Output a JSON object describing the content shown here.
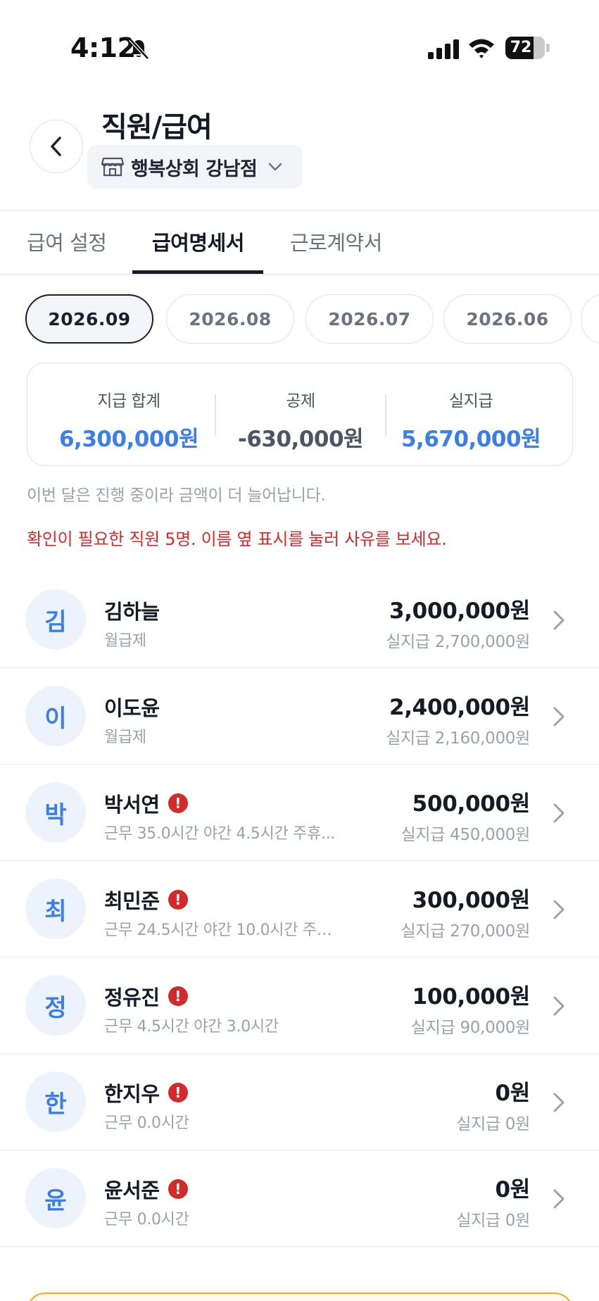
{
  "status_bar": {
    "time": "4:12",
    "battery": "72",
    "battery_level": 0.72
  },
  "header": {
    "title": "직원/급여",
    "store_name": "행복상회 강남점"
  },
  "tabs": [
    {
      "label": "급여 설정",
      "active": false
    },
    {
      "label": "급여명세서",
      "active": true
    },
    {
      "label": "근로계약서",
      "active": false
    }
  ],
  "months": [
    {
      "label": "2026.09",
      "active": true
    },
    {
      "label": "2026.08",
      "active": false
    },
    {
      "label": "2026.07",
      "active": false
    },
    {
      "label": "2026.06",
      "active": false
    }
  ],
  "summary": {
    "total_label": "지급 합계",
    "total_value": "6,300,000원",
    "deduction_label": "공제",
    "deduction_value": "-630,000원",
    "net_label": "실지급",
    "net_value": "5,670,000원"
  },
  "info_note": "이번 달은 진행 중이라 금액이 더 늘어납니다.",
  "warning": "확인이 필요한 직원 5명. 이름 옆 표시를 눌러 사유를 보세요.",
  "employees": [
    {
      "initial": "김",
      "name": "김하늘",
      "sub": "월급제",
      "amount": "3,000,000원",
      "net": "실지급 2,700,000원",
      "alert": false
    },
    {
      "initial": "이",
      "name": "이도윤",
      "sub": "월급제",
      "amount": "2,400,000원",
      "net": "실지급 2,160,000원",
      "alert": false
    },
    {
      "initial": "박",
      "name": "박서연",
      "sub": "근무 35.0시간  야간 4.5시간  주휴...",
      "amount": "500,000원",
      "net": "실지급 450,000원",
      "alert": true
    },
    {
      "initial": "최",
      "name": "최민준",
      "sub": "근무 24.5시간  야간 10.0시간  주…",
      "amount": "300,000원",
      "net": "실지급 270,000원",
      "alert": true
    },
    {
      "initial": "정",
      "name": "정유진",
      "sub": "근무 4.5시간  야간 3.0시간",
      "amount": "100,000원",
      "net": "실지급 90,000원",
      "alert": true
    },
    {
      "initial": "한",
      "name": "한지우",
      "sub": "근무 0.0시간",
      "amount": "0원",
      "net": "실지급 0원",
      "alert": true
    },
    {
      "initial": "윤",
      "name": "윤서준",
      "sub": "근무 0.0시간",
      "amount": "0원",
      "net": "실지급 0원",
      "alert": true
    }
  ],
  "alert_mark": "!",
  "colors": {
    "accent": "#3b7de9",
    "alert": "#d42a2a",
    "text": "#151a28",
    "muted": "#9aa1ad"
  }
}
